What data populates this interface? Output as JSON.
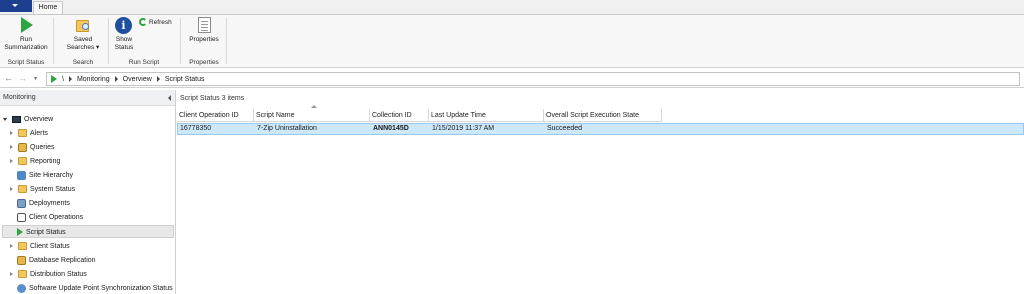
{
  "ribbon": {
    "tab_home": "Home",
    "run_summarization": {
      "line1": "Run",
      "line2": "Summarization"
    },
    "saved_searches": {
      "line1": "Saved",
      "line2": "Searches ▾"
    },
    "show_status": {
      "line1": "Show",
      "line2": "Status"
    },
    "refresh": "Refresh",
    "properties": "Properties",
    "groups": [
      "Script Status",
      "Search",
      "Run Script",
      "Properties"
    ]
  },
  "address": {
    "root": "\\",
    "crumbs": [
      "Monitoring",
      "Overview",
      "Script Status"
    ]
  },
  "nav": {
    "header": "Monitoring",
    "items": [
      {
        "label": "Overview"
      },
      {
        "label": "Alerts"
      },
      {
        "label": "Queries"
      },
      {
        "label": "Reporting"
      },
      {
        "label": "Site Hierarchy"
      },
      {
        "label": "System Status"
      },
      {
        "label": "Deployments"
      },
      {
        "label": "Client Operations"
      },
      {
        "label": "Script Status"
      },
      {
        "label": "Client Status"
      },
      {
        "label": "Database Replication"
      },
      {
        "label": "Distribution Status"
      },
      {
        "label": "Software Update Point Synchronization Status"
      }
    ]
  },
  "content": {
    "title": "Script Status 3 items",
    "columns": [
      "Client Operation ID",
      "Script Name",
      "Collection ID",
      "Last Update Time",
      "Overall Script Execution State"
    ],
    "rows": [
      [
        "16778350",
        "7-Zip Uninstallation",
        "ANN0145D",
        "1/15/2019 11:37 AM",
        "Succeeded"
      ]
    ]
  },
  "colors": {
    "accent_blue": "#1e3f8f",
    "selection": "#cde8fb",
    "run_green": "#2aa640"
  }
}
